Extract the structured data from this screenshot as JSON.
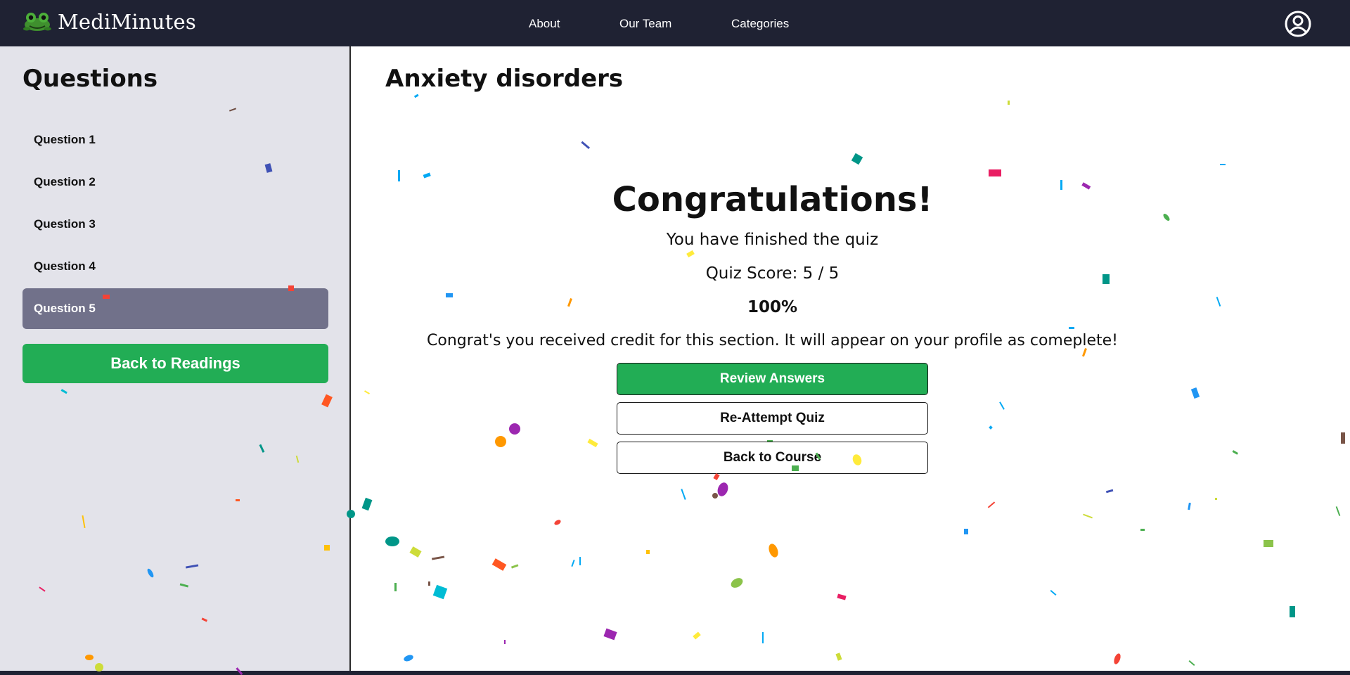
{
  "navbar": {
    "brand": "MediMinutes",
    "links": [
      "About",
      "Our Team",
      "Categories"
    ],
    "logo_icon": "frog-logo-icon",
    "profile_icon": "user-circle-icon"
  },
  "sidebar": {
    "title": "Questions",
    "questions": [
      "Question 1",
      "Question 2",
      "Question 3",
      "Question 4",
      "Question 5"
    ],
    "active_question": "Question 5",
    "back_button": "Back to Readings"
  },
  "main": {
    "title": "Anxiety disorders",
    "congrats": "Congratulations!",
    "finished_text": "You have finished the quiz",
    "score_text": "Quiz Score: 5 / 5",
    "percent_text": "100%",
    "credit_text": "Congrat's you received credit for this section. It will appear on your profile as comeplete!",
    "buttons": {
      "review": "Review Answers",
      "reattempt": "Re-Attempt Quiz",
      "course": "Back to Course"
    }
  },
  "colors": {
    "navbar_bg": "#1f2233",
    "sidebar_bg": "#e3e3ea",
    "active_item_bg": "#71718a",
    "accent_green": "#22ad55"
  }
}
